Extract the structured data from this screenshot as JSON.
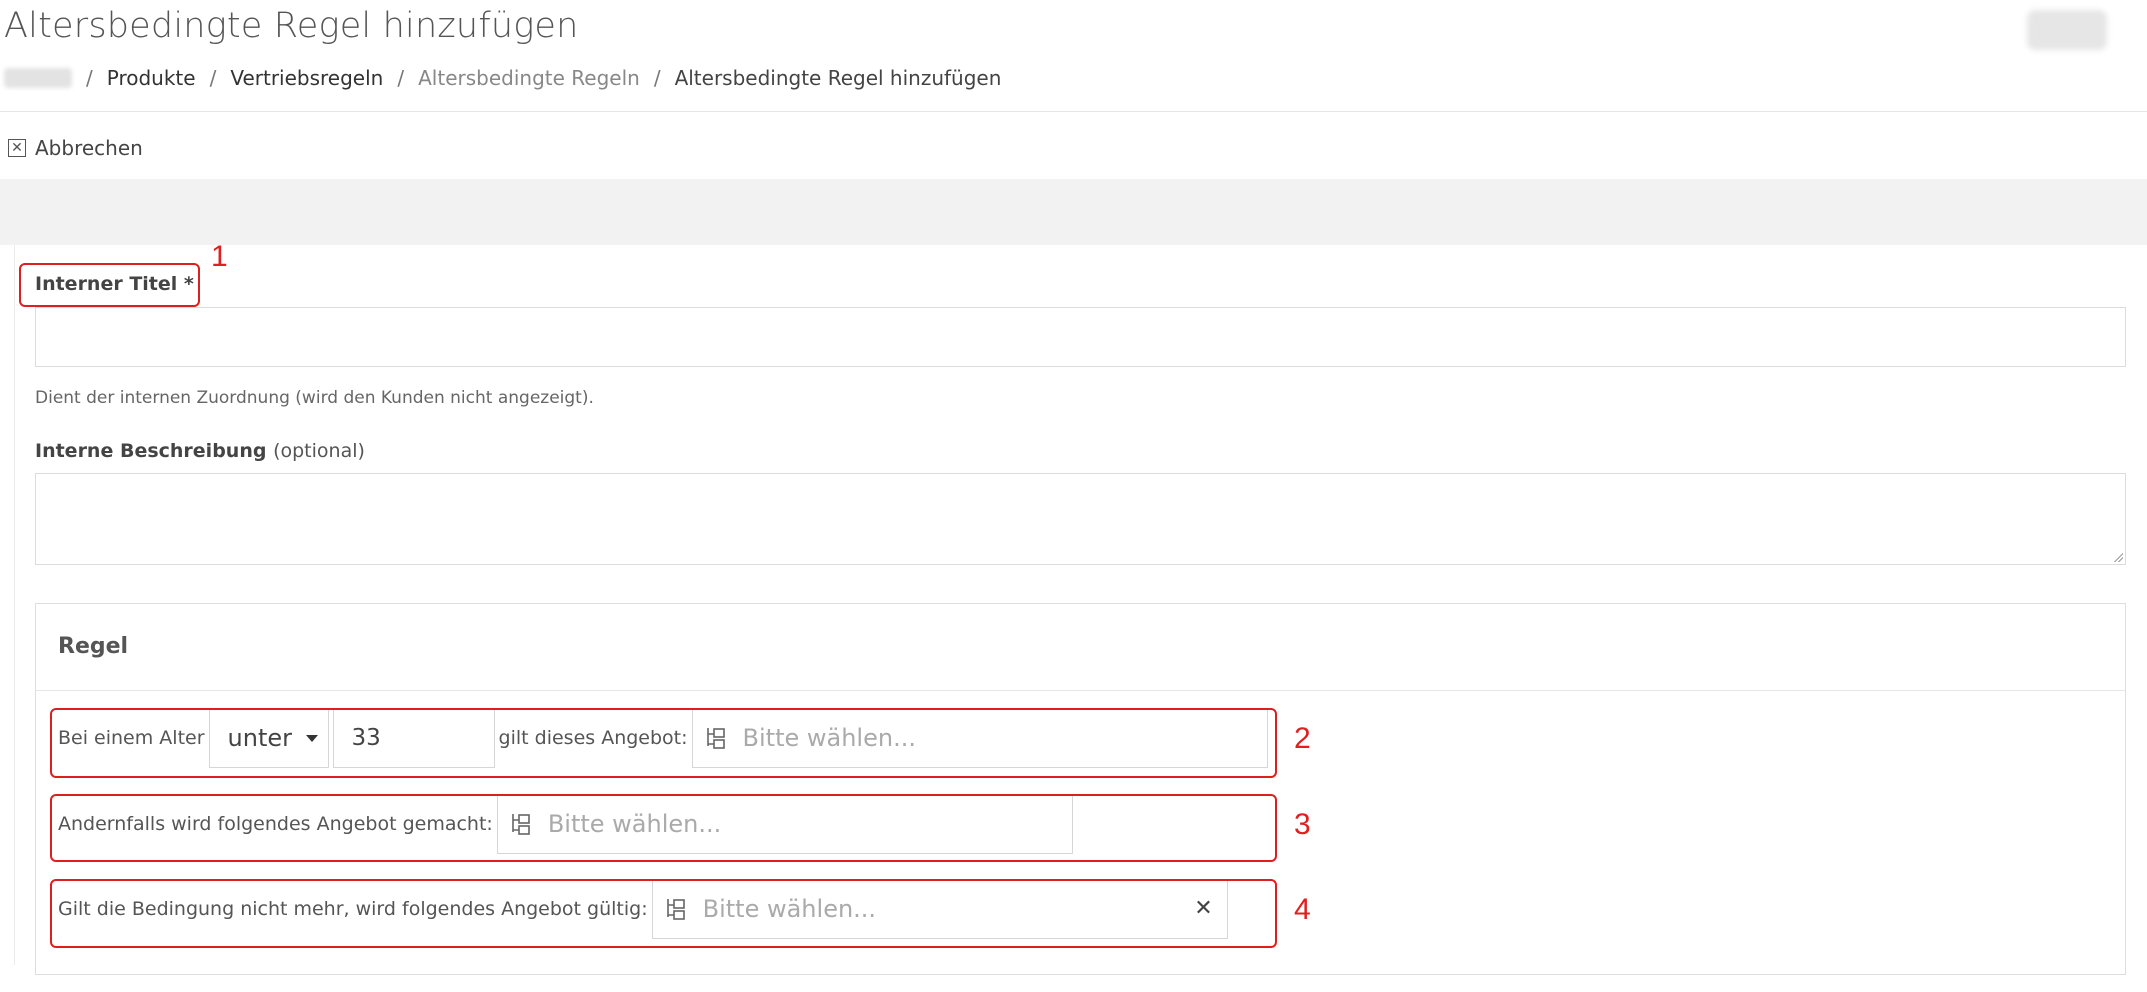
{
  "page": {
    "title": "Altersbedingte Regel hinzufügen"
  },
  "breadcrumb": {
    "items": [
      "Produkte",
      "Vertriebsregeln",
      "Altersbedingte Regeln",
      "Altersbedingte Regel hinzufügen"
    ],
    "separator": "/"
  },
  "toolbar": {
    "cancel_label": "Abbrechen",
    "cancel_icon": "close-box-icon"
  },
  "form": {
    "title_label": "Interner Titel",
    "required_mark": "*",
    "title_value": "",
    "title_help": "Dient der internen Zuordnung (wird den Kunden nicht angezeigt).",
    "description_label": "Interne Beschreibung",
    "description_optional": "(optional)",
    "description_value": ""
  },
  "rule": {
    "heading": "Regel",
    "row1_prefix": "Bei einem Alter",
    "comparison": "unter",
    "age_value": "33",
    "row1_middle": "gilt dieses Angebot:",
    "row1_placeholder": "Bitte wählen...",
    "row2_prefix": "Andernfalls wird folgendes Angebot gemacht:",
    "row2_placeholder": "Bitte wählen...",
    "row3_prefix": "Gilt die Bedingung nicht mehr, wird folgendes Angebot gültig:",
    "row3_placeholder": "Bitte wählen...",
    "clear_symbol": "✕",
    "picker_icon": "tree-structure-icon"
  },
  "annotations": [
    "1",
    "2",
    "3",
    "4"
  ],
  "colors": {
    "annotation": "#dd1f1f",
    "band": "#f2f2f2",
    "border": "#dcdcdc"
  }
}
